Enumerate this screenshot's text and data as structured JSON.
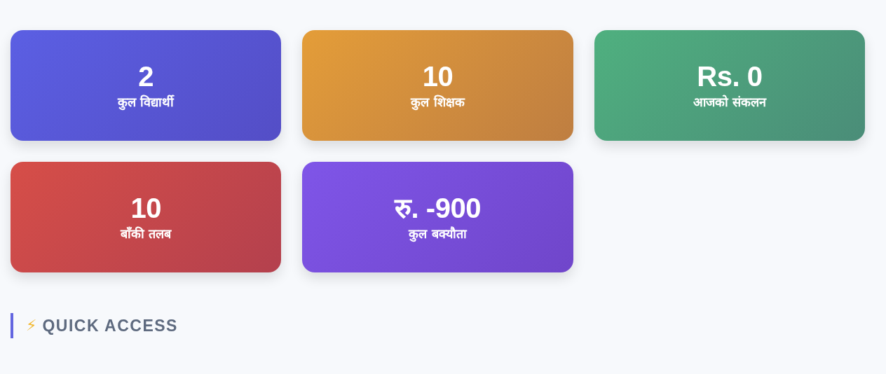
{
  "stats": [
    {
      "value": "2",
      "label": "कुल विद्यार्थी",
      "color": "#5b5fe3"
    },
    {
      "value": "10",
      "label": "कुल शिक्षक",
      "color": "#e49d38"
    },
    {
      "value": "Rs. 0",
      "label": "आजको संकलन",
      "color": "#4fb07f"
    },
    {
      "value": "10",
      "label": "बाँकी तलब",
      "color": "#d64e48"
    },
    {
      "value": "रु. -900",
      "label": "कुल बक्यौता",
      "color": "#7f55e8"
    }
  ],
  "section": {
    "icon": "⚡",
    "title": "QUICK ACCESS"
  }
}
